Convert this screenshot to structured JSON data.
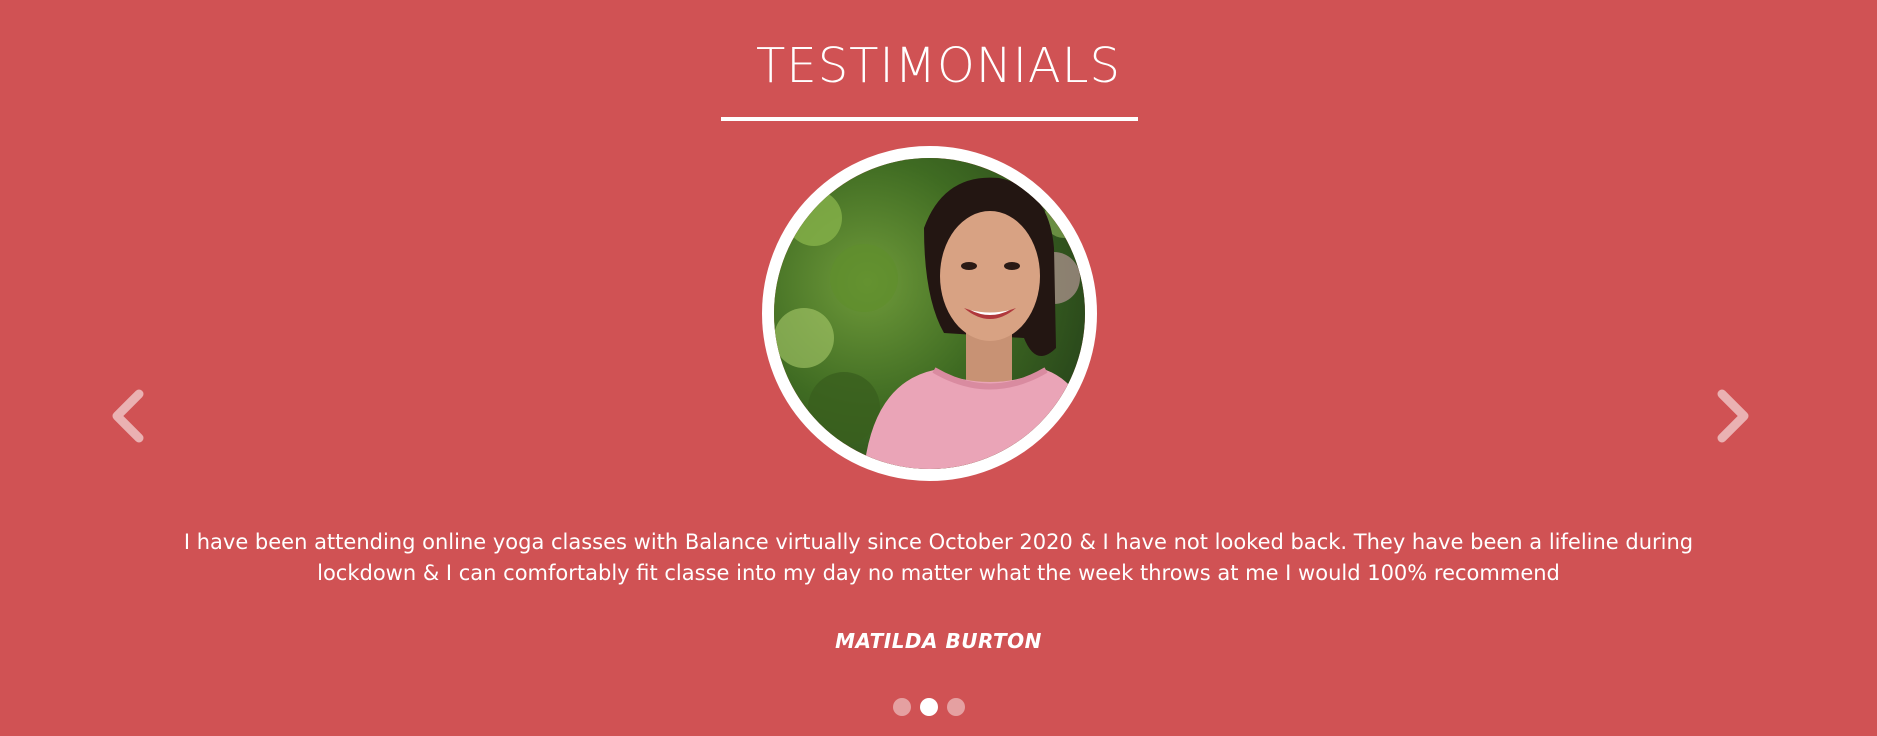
{
  "section": {
    "title": "TESTIMONIALS"
  },
  "testimonial": {
    "quote": "I have been attending online yoga classes with Balance virtually since October 2020 & I have not looked back. They have been a lifeline during lockdown & I can comfortably fit classe into my day no matter what the week throws at me I would 100% recommend",
    "author": "MATILDA BURTON"
  },
  "carousel": {
    "prev_icon": "chevron-left-icon",
    "next_icon": "chevron-right-icon",
    "slide_count": 3,
    "active_index": 1
  },
  "colors": {
    "background": "#d05254",
    "text": "#ffffff"
  }
}
